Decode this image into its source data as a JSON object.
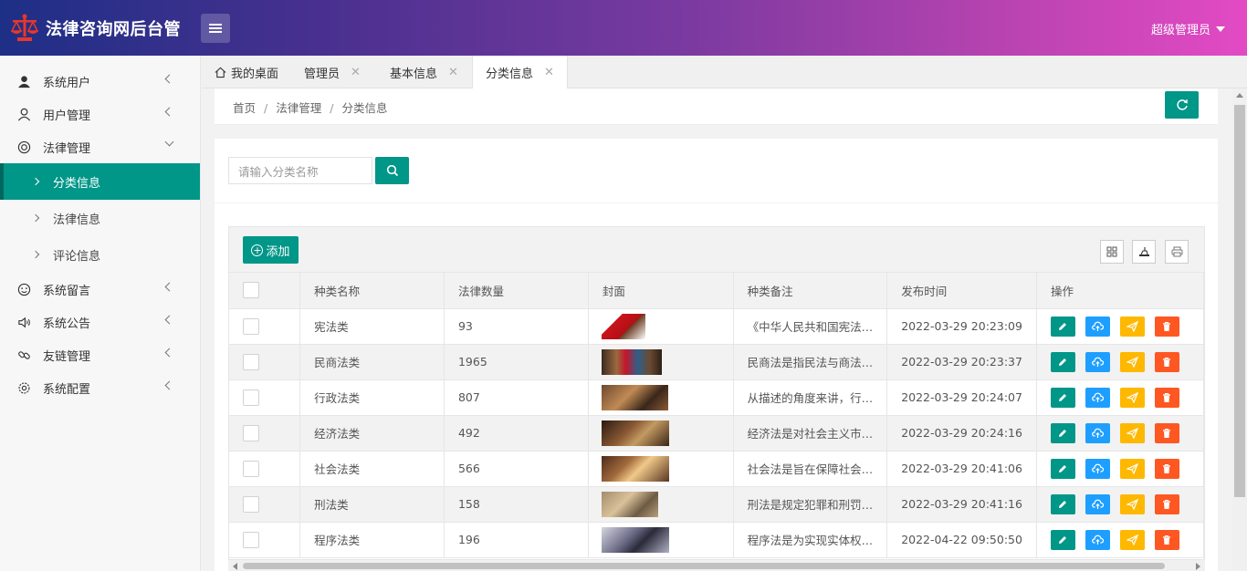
{
  "app": {
    "title": "法律咨询网后台管",
    "user": "超级管理员"
  },
  "colors": {
    "primary": "#009688",
    "blue": "#1e9fff",
    "warm": "#ffb800",
    "danger": "#ff5722"
  },
  "sidebar": {
    "items": [
      {
        "label": "系统用户",
        "icon": "user-solid-icon"
      },
      {
        "label": "用户管理",
        "icon": "user-outline-icon"
      },
      {
        "label": "法律管理",
        "icon": "target-icon"
      },
      {
        "label": "系统留言",
        "icon": "smile-icon"
      },
      {
        "label": "系统公告",
        "icon": "speaker-icon"
      },
      {
        "label": "友链管理",
        "icon": "link-icon"
      },
      {
        "label": "系统配置",
        "icon": "gear-icon"
      }
    ],
    "sub": [
      "分类信息",
      "法律信息",
      "评论信息"
    ]
  },
  "tabs": [
    {
      "label": "我的桌面",
      "closable": false
    },
    {
      "label": "管理员",
      "closable": true
    },
    {
      "label": "基本信息",
      "closable": true
    },
    {
      "label": "分类信息",
      "closable": true
    }
  ],
  "breadcrumb": [
    "首页",
    "法律管理",
    "分类信息"
  ],
  "search": {
    "placeholder": "请输入分类名称"
  },
  "toolbar": {
    "add_label": "添加"
  },
  "table": {
    "columns": [
      "种类名称",
      "法律数量",
      "封面",
      "种类备注",
      "发布时间",
      "操作"
    ],
    "rows": [
      {
        "name": "宪法类",
        "count": "93",
        "note": "《中华人民共和国宪法…",
        "time": "2022-03-29 20:23:09"
      },
      {
        "name": "民商法类",
        "count": "1965",
        "note": "民商法是指民法与商法…",
        "time": "2022-03-29 20:23:37"
      },
      {
        "name": "行政法类",
        "count": "807",
        "note": "从描述的角度来讲，行…",
        "time": "2022-03-29 20:24:07"
      },
      {
        "name": "经济法类",
        "count": "492",
        "note": "经济法是对社会主义市…",
        "time": "2022-03-29 20:24:16"
      },
      {
        "name": "社会法类",
        "count": "566",
        "note": "社会法是旨在保障社会…",
        "time": "2022-03-29 20:41:06"
      },
      {
        "name": "刑法类",
        "count": "158",
        "note": "刑法是规定犯罪和刑罚…",
        "time": "2022-03-29 20:41:16"
      },
      {
        "name": "程序法类",
        "count": "196",
        "note": "程序法是为实现实体权…",
        "time": "2022-04-22 09:50:50"
      }
    ]
  }
}
